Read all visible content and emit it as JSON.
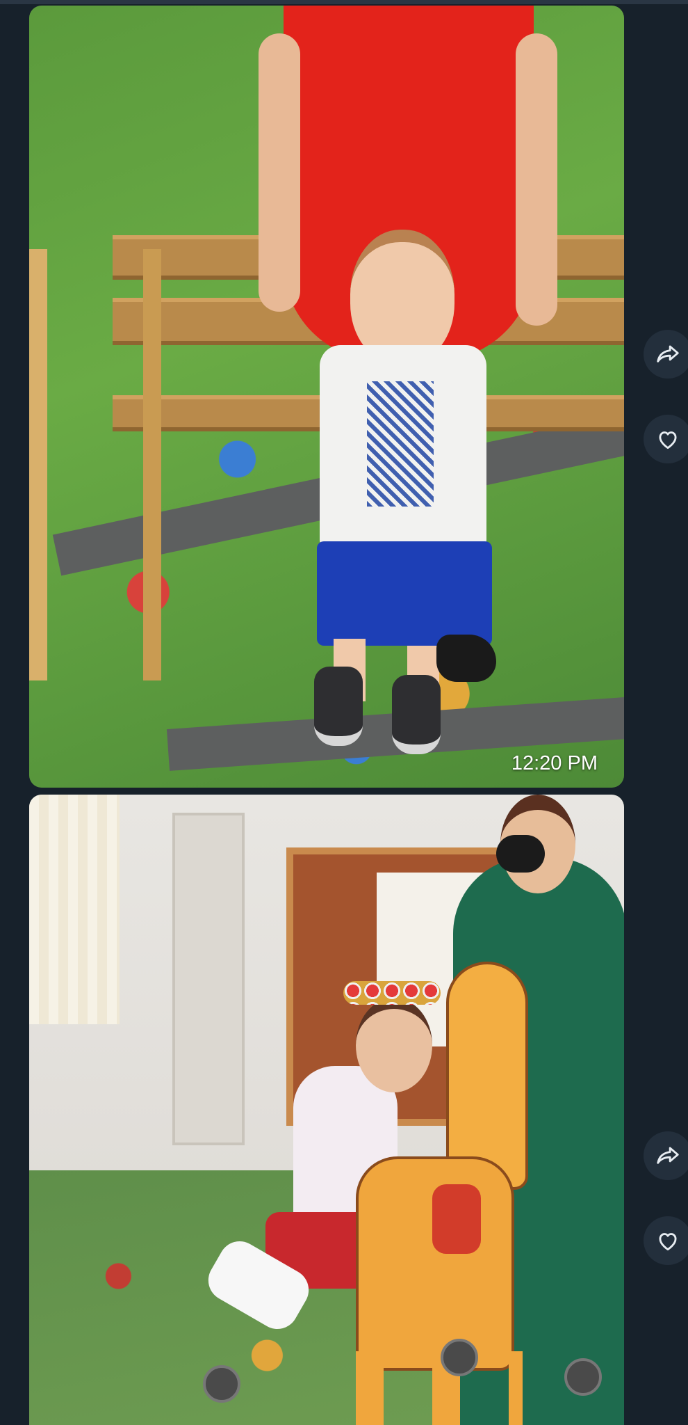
{
  "feed": {
    "posts": [
      {
        "media": "photo",
        "timestamp": "12:20 PM",
        "actions": {
          "share_icon": "share-icon",
          "like_icon": "heart-icon"
        }
      },
      {
        "media": "photo",
        "actions": {
          "share_icon": "share-icon",
          "like_icon": "heart-icon"
        }
      }
    ]
  },
  "colors": {
    "background": "#17212b",
    "button_bg": "#232f3c",
    "icon": "#e8edf2"
  }
}
